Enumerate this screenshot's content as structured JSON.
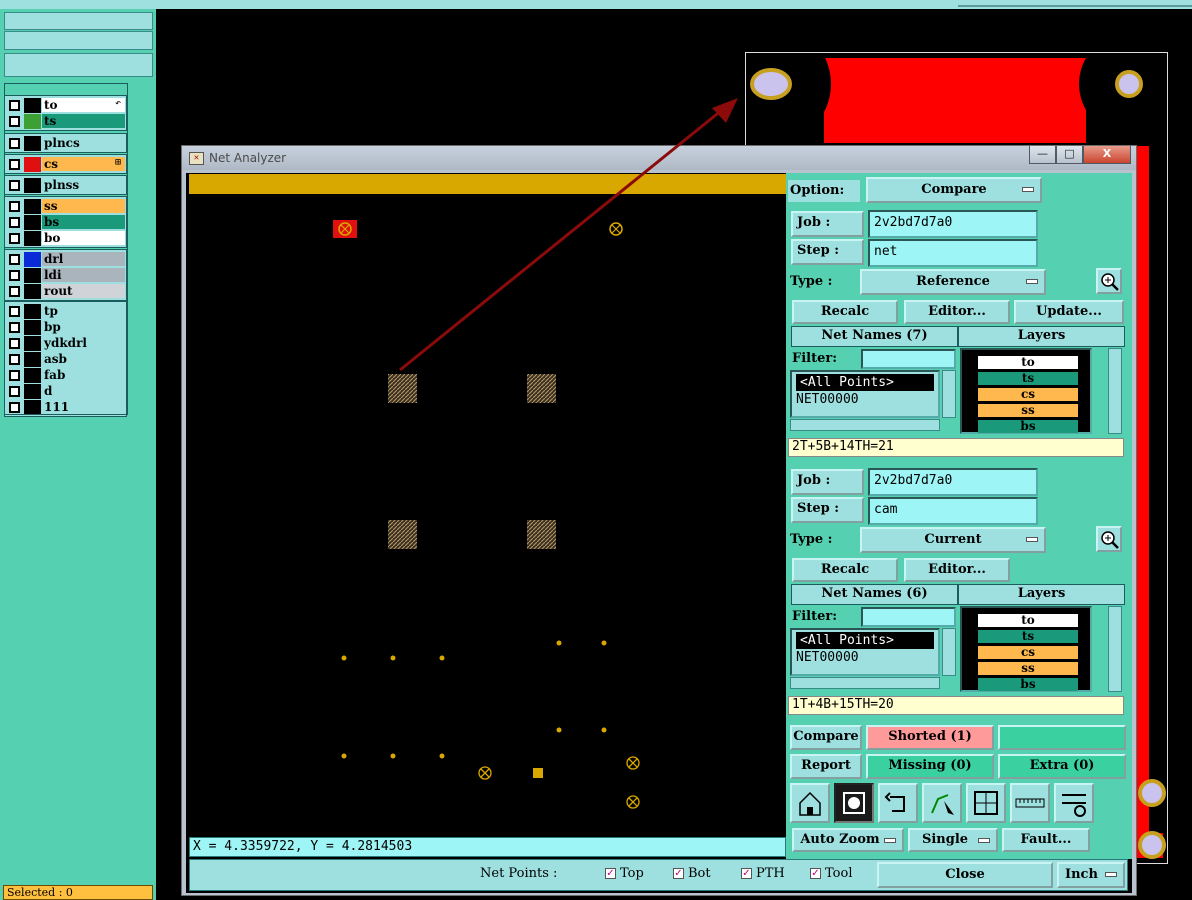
{
  "window": {
    "title": "Net Analyzer",
    "minimize": "—",
    "maximize": "□",
    "close": "X"
  },
  "left_panel": {
    "groups": [
      [
        {
          "name": "to",
          "color": "#ffffff",
          "swatch": "#000000",
          "mark": "↶"
        },
        {
          "name": "ts",
          "color": "#1a9a7a",
          "swatch": "#3ca035",
          "mark": ""
        }
      ],
      [
        {
          "name": "plncs",
          "color": "#9ee0e0",
          "swatch": "#000000",
          "mark": ""
        }
      ],
      [
        {
          "name": "cs",
          "color": "#ffb84d",
          "swatch": "#e01010",
          "mark": "⊞"
        }
      ],
      [
        {
          "name": "plnss",
          "color": "#9ee0e0",
          "swatch": "#000000",
          "mark": ""
        }
      ],
      [
        {
          "name": "ss",
          "color": "#ffb84d",
          "swatch": "#000000",
          "mark": ""
        },
        {
          "name": "bs",
          "color": "#1a9a7a",
          "swatch": "#000000",
          "mark": ""
        },
        {
          "name": "bo",
          "color": "#ffffff",
          "swatch": "#000000",
          "mark": ""
        }
      ],
      [
        {
          "name": "drl",
          "color": "#aab4bc",
          "swatch": "#0a2ad8",
          "mark": ""
        },
        {
          "name": "ldi",
          "color": "#aab4bc",
          "swatch": "#000000",
          "mark": ""
        },
        {
          "name": "rout",
          "color": "#d0d4d8",
          "swatch": "#000000",
          "mark": ""
        }
      ],
      [
        {
          "name": "tp",
          "color": "#9ee0e0",
          "swatch": "#000000",
          "mark": ""
        },
        {
          "name": "bp",
          "color": "#9ee0e0",
          "swatch": "#000000",
          "mark": ""
        },
        {
          "name": "ydkdrl",
          "color": "#9ee0e0",
          "swatch": "#000000",
          "mark": ""
        },
        {
          "name": "asb",
          "color": "#9ee0e0",
          "swatch": "#000000",
          "mark": ""
        },
        {
          "name": "fab",
          "color": "#9ee0e0",
          "swatch": "#000000",
          "mark": ""
        },
        {
          "name": "d",
          "color": "#9ee0e0",
          "swatch": "#000000",
          "mark": ""
        },
        {
          "name": "111",
          "color": "#9ee0e0",
          "swatch": "#000000",
          "mark": ""
        }
      ]
    ],
    "selected": "Selected : 0"
  },
  "canvas": {
    "coordinates": "X = 4.3359722, Y = 4.2814503"
  },
  "controls": {
    "option_label": "Option:",
    "option_value": "Compare",
    "reference": {
      "job_label": "Job  :",
      "job_value": "2v2bd7d7a0",
      "step_label": "Step :",
      "step_value": "net",
      "type_label": "Type :",
      "type_value": "Reference",
      "recalc": "Recalc",
      "editor": "Editor...",
      "update": "Update...",
      "net_names": "Net Names (7)",
      "layers_header": "Layers",
      "filter_label": "Filter:",
      "nets": [
        "<All Points>",
        "NET00000"
      ],
      "layers": [
        {
          "name": "to",
          "color": "#ffffff"
        },
        {
          "name": "ts",
          "color": "#1a9a7a"
        },
        {
          "name": "cs",
          "color": "#ffb84d"
        },
        {
          "name": "ss",
          "color": "#ffb84d"
        },
        {
          "name": "bs",
          "color": "#1a9a7a"
        }
      ],
      "summary": "2T+5B+14TH=21"
    },
    "current": {
      "job_label": "Job  :",
      "job_value": "2v2bd7d7a0",
      "step_label": "Step :",
      "step_value": "cam",
      "type_label": "Type :",
      "type_value": "Current",
      "recalc": "Recalc",
      "editor": "Editor...",
      "net_names": "Net Names (6)",
      "layers_header": "Layers",
      "filter_label": "Filter:",
      "nets": [
        "<All Points>",
        "NET00000"
      ],
      "layers": [
        {
          "name": "to",
          "color": "#ffffff"
        },
        {
          "name": "ts",
          "color": "#1a9a7a"
        },
        {
          "name": "cs",
          "color": "#ffb84d"
        },
        {
          "name": "ss",
          "color": "#ffb84d"
        },
        {
          "name": "bs",
          "color": "#1a9a7a"
        }
      ],
      "summary": "1T+4B+15TH=20"
    },
    "compare_btn": "Compare",
    "report_btn": "Report",
    "shorted": "Shorted (1)",
    "missing": "Missing (0)",
    "extra": "Extra (0)",
    "auto_zoom": "Auto Zoom",
    "single": "Single",
    "fault": "Fault...",
    "colors": {
      "shorted_bg": "#ff9a9a",
      "missing_bg": "#3ad0a0",
      "extra_bg": "#3ad0a0"
    }
  },
  "bottom": {
    "net_points_label": "Net Points :",
    "options": [
      {
        "label": "Top",
        "checked": true
      },
      {
        "label": "Bot",
        "checked": true
      },
      {
        "label": "PTH",
        "checked": true
      },
      {
        "label": "Tool",
        "checked": true
      }
    ],
    "close": "Close",
    "units": "Inch"
  }
}
